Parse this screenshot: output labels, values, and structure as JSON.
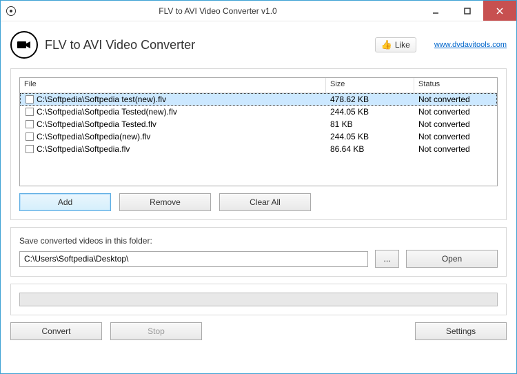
{
  "window": {
    "title": "FLV to AVI Video Converter v1.0"
  },
  "header": {
    "app_title": "FLV to AVI Video Converter",
    "like_label": "Like",
    "website": "www.dvdavitools.com"
  },
  "table": {
    "headers": {
      "file": "File",
      "size": "Size",
      "status": "Status"
    },
    "rows": [
      {
        "file": "C:\\Softpedia\\Softpedia test(new).flv",
        "size": "478.62 KB",
        "status": "Not converted",
        "selected": true
      },
      {
        "file": "C:\\Softpedia\\Softpedia Tested(new).flv",
        "size": "244.05 KB",
        "status": "Not converted",
        "selected": false
      },
      {
        "file": "C:\\Softpedia\\Softpedia Tested.flv",
        "size": "81 KB",
        "status": "Not converted",
        "selected": false
      },
      {
        "file": "C:\\Softpedia\\Softpedia(new).flv",
        "size": "244.05 KB",
        "status": "Not converted",
        "selected": false
      },
      {
        "file": "C:\\Softpedia\\Softpedia.flv",
        "size": "86.64 KB",
        "status": "Not converted",
        "selected": false
      }
    ]
  },
  "buttons": {
    "add": "Add",
    "remove": "Remove",
    "clear_all": "Clear All",
    "browse": "...",
    "open": "Open",
    "convert": "Convert",
    "stop": "Stop",
    "settings": "Settings"
  },
  "save": {
    "label": "Save converted videos in this folder:",
    "path": "C:\\Users\\Softpedia\\Desktop\\"
  }
}
